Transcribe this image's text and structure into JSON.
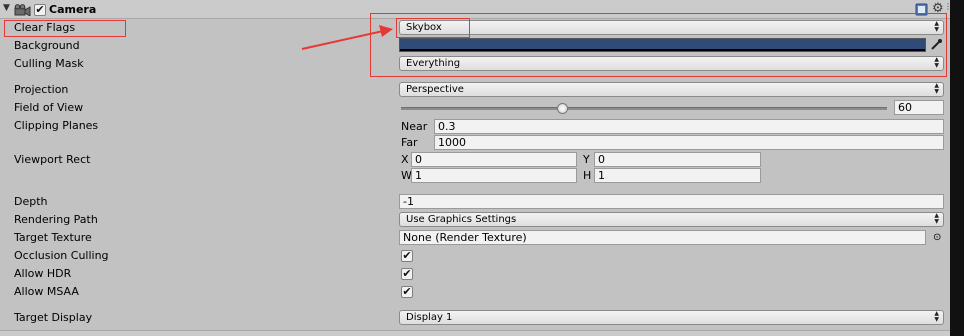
{
  "component": {
    "title": "Camera",
    "enabled_check": "✔",
    "help_icon": "help-book-icon",
    "settings_icon": "gear-icon"
  },
  "properties": {
    "clear_flags": {
      "label": "Clear Flags",
      "value": "Skybox"
    },
    "background": {
      "label": "Background",
      "color": "#2f4b77"
    },
    "culling_mask": {
      "label": "Culling Mask",
      "value": "Everything"
    },
    "projection": {
      "label": "Projection",
      "value": "Perspective"
    },
    "field_of_view": {
      "label": "Field of View",
      "value": "60",
      "slider_fraction": 0.33
    },
    "clipping_planes": {
      "label": "Clipping Planes",
      "near_label": "Near",
      "near": "0.3",
      "far_label": "Far",
      "far": "1000"
    },
    "viewport_rect": {
      "label": "Viewport Rect",
      "x_label": "X",
      "x": "0",
      "y_label": "Y",
      "y": "0",
      "w_label": "W",
      "w": "1",
      "h_label": "H",
      "h": "1"
    },
    "depth": {
      "label": "Depth",
      "value": "-1"
    },
    "rendering_path": {
      "label": "Rendering Path",
      "value": "Use Graphics Settings"
    },
    "target_texture": {
      "label": "Target Texture",
      "value": "None (Render Texture)"
    },
    "occlusion_culling": {
      "label": "Occlusion Culling",
      "checked": "✔"
    },
    "allow_hdr": {
      "label": "Allow HDR",
      "checked": "✔"
    },
    "allow_msaa": {
      "label": "Allow MSAA",
      "checked": "✔"
    },
    "target_display": {
      "label": "Target Display",
      "value": "Display 1"
    }
  },
  "glyphs": {
    "dropdown_arrow": "▲▼",
    "picker_dot": "⊙"
  },
  "annotation_color": "#e53935"
}
